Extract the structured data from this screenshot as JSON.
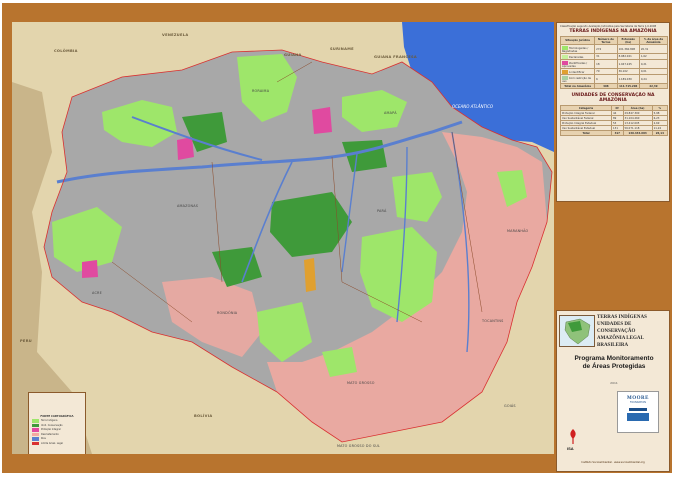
{
  "map": {
    "countries": [
      "COLÔMBIA",
      "VENEZUELA",
      "GUIANA",
      "SURINAME",
      "GUIANA FRANCESA",
      "PERU",
      "BOLÍVIA"
    ],
    "states": [
      "RORAIMA",
      "AMAPÁ",
      "AMAZONAS",
      "PARÁ",
      "MARANHÃO",
      "ACRE",
      "RONDÔNIA",
      "MATO GROSSO",
      "TOCANTINS",
      "MATO GROSSO DO SUL",
      "GOIÁS"
    ],
    "ocean_label": "OCEANO ATLÂNTICO",
    "colors": {
      "indigenous_land": "#9ee66a",
      "conservation_unit": "#3f9a3a",
      "strict_protection": "#e04aa0",
      "mining_overlap": "#e0a030",
      "deforestation": "#f4a9a0",
      "water": "#5a7fcf",
      "ocean": "#3b6fd8",
      "neighbor_land": "#e3d5ad",
      "border_frame": "#b8742e"
    }
  },
  "legend_top": {
    "note": "Classificação segundo Avaliação Indicativa pela Secretaria da Terra 1.0-2008",
    "indigenous_title": "TERRAS INDÍGENAS NA AMAZÔNIA",
    "indigenous_headers": [
      "Situação Jurídica",
      "Número de Terras",
      "Extensão (ha)",
      "% da área da Amazônia"
    ],
    "indigenous_rows": [
      {
        "label": "Homologadas / Registradas",
        "values": [
          "274",
          "101.360.808",
          "20,31"
        ]
      },
      {
        "label": "Declaradas",
        "values": [
          "31",
          "8.082.021",
          "1,62"
        ]
      },
      {
        "label": "Identificadas / Aprovadas",
        "values": [
          "18",
          "1.047.245",
          "0,21"
        ]
      },
      {
        "label": "A identificar",
        "values": [
          "79",
          "36.102",
          "0,01"
        ]
      },
      {
        "label": "Com restrição de uso",
        "values": [
          "6",
          "1.189.030",
          "0,24"
        ]
      }
    ],
    "indigenous_total": {
      "label": "Total na Amazônia",
      "values": [
        "408",
        "111.715.206",
        "22,39"
      ]
    },
    "conservation_title": "UNIDADES DE CONSERVAÇÃO NA AMAZÔNIA",
    "conservation_headers": [
      "Categoria",
      "Nº",
      "Área (ha)",
      "%"
    ],
    "conservation_rows": [
      {
        "label": "Proteção Integral Federal",
        "values": [
          "44",
          "29.847.300",
          "5,98"
        ]
      },
      {
        "label": "Uso Sustentável Federal",
        "values": [
          "89",
          "31.104.260",
          "6,23"
        ]
      },
      {
        "label": "Proteção Integral Estadual",
        "values": [
          "53",
          "13.412.005",
          "2,69"
        ]
      },
      {
        "label": "Uso Sustentável Estadual",
        "values": [
          "131",
          "56.071.118",
          "11,24"
        ]
      }
    ],
    "conservation_total": {
      "label": "Total",
      "values": [
        "317",
        "130.434.683",
        "26,14"
      ]
    }
  },
  "legend_bottom": {
    "titles": [
      "TERRAS INDÍGENAS",
      "UNIDADES DE CONSERVAÇÃO",
      "AMAZÔNIA LEGAL BRASILEIRA"
    ],
    "program": [
      "Programa Monitoramento",
      "de Áreas Protegidas"
    ],
    "year": "2011",
    "sponsor": "MOORE",
    "sponsor_sub": "FOUNDATION",
    "isa": "ISA",
    "footer": "Instituto Socioambiental · www.socioambiental.org"
  },
  "map_legend": {
    "heading": "FONTE CARTOGRÁFICA",
    "items": [
      {
        "label": "Terra Indígena",
        "color": "#9ee66a"
      },
      {
        "label": "Unid. Conservação",
        "color": "#3f9a3a"
      },
      {
        "label": "Proteção Integral",
        "color": "#e04aa0"
      },
      {
        "label": "Desmatamento",
        "color": "#f4a9a0"
      },
      {
        "label": "Rios",
        "color": "#5a7fcf"
      },
      {
        "label": "Limite Amaz. Legal",
        "color": "#d93030"
      }
    ]
  }
}
